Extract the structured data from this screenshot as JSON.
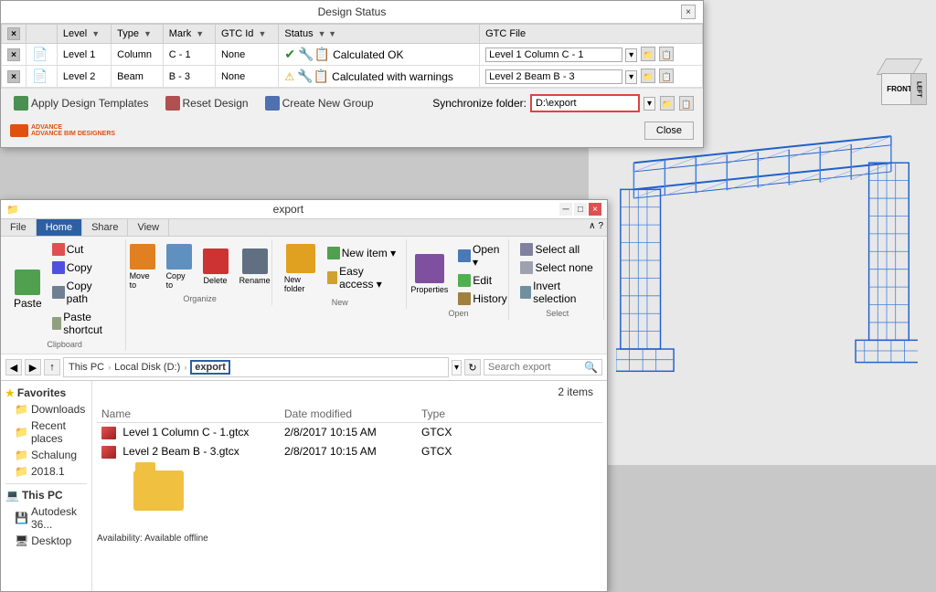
{
  "design_status": {
    "title": "Design Status",
    "close_btn": "×",
    "table": {
      "headers": [
        "",
        "",
        "Level",
        "Type",
        "Mark",
        "GTC Id",
        "Status",
        "GTC File"
      ],
      "rows": [
        {
          "checked": true,
          "level": "Level 1",
          "type": "Column",
          "mark": "C - 1",
          "gtc_id": "None",
          "status": "Calculated OK",
          "status_icon": "✓",
          "status_type": "ok",
          "gtc_file": "Level 1 Column C - 1"
        },
        {
          "checked": true,
          "level": "Level 2",
          "type": "Beam",
          "mark": "B - 3",
          "gtc_id": "None",
          "status": "Calculated with warnings",
          "status_icon": "⚠",
          "status_type": "warn",
          "gtc_file": "Level 2 Beam B - 3"
        }
      ]
    },
    "toolbar": {
      "apply_label": "Apply Design Templates",
      "reset_label": "Reset Design",
      "create_label": "Create New Group",
      "sync_label": "Synchronize folder:",
      "sync_value": "D:\\export",
      "close_label": "Close"
    },
    "brand": "ADVANCE BIM DESIGNERS"
  },
  "explorer": {
    "title": "export",
    "min_btn": "─",
    "max_btn": "□",
    "close_btn": "×",
    "ribbon_tabs": [
      "File",
      "Home",
      "Share",
      "View"
    ],
    "active_tab": "Home",
    "ribbon_groups": {
      "clipboard": {
        "label": "Clipboard",
        "copy_btn": "Copy",
        "paste_btn": "Paste",
        "cut_btn": "Cut",
        "copy_path_btn": "Copy path",
        "paste_shortcut_btn": "Paste shortcut"
      },
      "organize": {
        "label": "Organize",
        "move_to_btn": "Move to",
        "copy_to_btn": "Copy to",
        "delete_btn": "Delete",
        "rename_btn": "Rename"
      },
      "new": {
        "label": "New",
        "new_folder_btn": "New folder",
        "new_item_btn": "New item ▾",
        "easy_access_btn": "Easy access ▾"
      },
      "open": {
        "label": "Open",
        "properties_btn": "Properties",
        "open_btn": "Open ▾",
        "edit_btn": "Edit",
        "history_btn": "History"
      },
      "select": {
        "label": "Select",
        "select_all_btn": "Select all",
        "select_none_btn": "Select none",
        "invert_btn": "Invert selection"
      }
    },
    "address": {
      "path_segments": [
        "This PC",
        "Local Disk (D:)",
        "export"
      ],
      "current_folder": "export",
      "search_placeholder": "Search export"
    },
    "sidebar": {
      "favorites_label": "Favorites",
      "items": [
        {
          "label": "Downloads",
          "icon": "📁"
        },
        {
          "label": "Recent places",
          "icon": "📁"
        },
        {
          "label": "Schalung",
          "icon": "📁"
        },
        {
          "label": "2018.1",
          "icon": "📁"
        }
      ],
      "this_pc_label": "This PC",
      "pc_items": [
        {
          "label": "Autodesk 36...",
          "icon": "💻"
        },
        {
          "label": "Desktop",
          "icon": "🖥"
        }
      ]
    },
    "files": {
      "count": "2 items",
      "headers": [
        "Name",
        "Date modified",
        "Type"
      ],
      "rows": [
        {
          "name": "Level 1 Column C - 1.gtcx",
          "date": "2/8/2017 10:15 AM",
          "type": "GTCX"
        },
        {
          "name": "Level 2 Beam B - 3.gtcx",
          "date": "2/8/2017 10:15 AM",
          "type": "GTCX"
        }
      ]
    },
    "folder_availability": "Availability:  Available offline"
  }
}
